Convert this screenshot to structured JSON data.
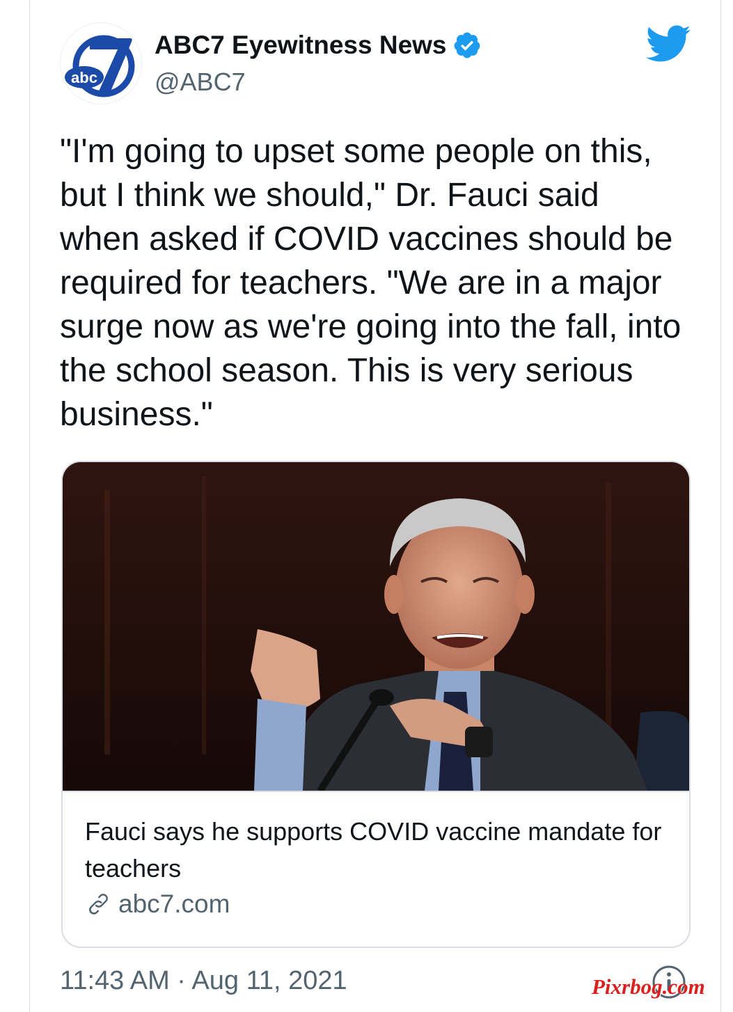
{
  "tweet": {
    "author": {
      "name": "ABC7 Eyewitness News",
      "handle": "@ABC7",
      "avatar_icon": "abc7-logo",
      "verified_icon": "verified-badge-icon"
    },
    "text": "\"I'm going to upset some people on this, but I think we should,\" Dr. Fauci said when asked if COVID vaccines should be required for teachers. \"We are in a major surge now as we're going into the fall, into the school season. This is very serious business.\"",
    "link_card": {
      "image_description_icon": "photo",
      "title": "Fauci says he supports COVID vaccine mandate for teachers",
      "source": "abc7.com",
      "source_icon": "link-icon"
    },
    "timestamp": "11:43 AM · Aug 11, 2021"
  },
  "watermark": "Pixrbog.com",
  "colors": {
    "twitter_blue": "#1d9bf0",
    "secondary_text": "#536471",
    "primary_text": "#0f1419",
    "watermark_red": "#d9201c",
    "abc_blue": "#1b4aa8"
  }
}
